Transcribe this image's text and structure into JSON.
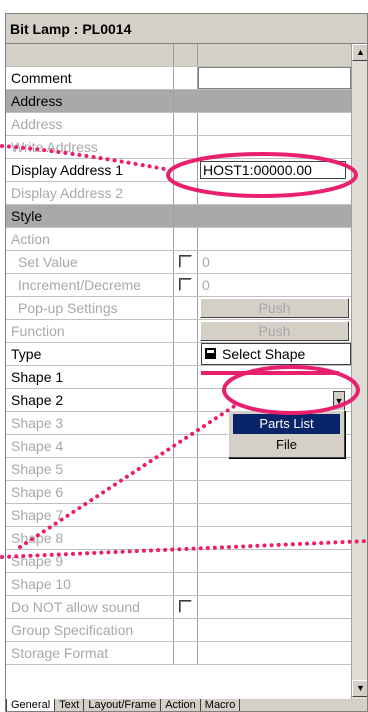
{
  "window": {
    "title": "Bit Lamp : PL0014"
  },
  "rows": [
    {
      "label": "Comment",
      "style": "normal",
      "value": "",
      "col2": "empty"
    },
    {
      "label": "Address",
      "style": "section"
    },
    {
      "label": "Address",
      "style": "disabled",
      "value": ""
    },
    {
      "label": "Write Address",
      "style": "disabled",
      "value": ""
    },
    {
      "label": "Display Address 1",
      "style": "normal",
      "value": "HOST1:00000.00"
    },
    {
      "label": "Display Address 2",
      "style": "disabled",
      "value": ""
    },
    {
      "label": "Style",
      "style": "section"
    },
    {
      "label": "Action",
      "style": "disabled",
      "value": ""
    },
    {
      "label": "Set Value",
      "style": "disabled-indent",
      "value": "0",
      "check": true
    },
    {
      "label": "Increment/Decreme",
      "style": "disabled-indent",
      "value": "0",
      "check": true
    },
    {
      "label": "Pop-up Settings",
      "style": "disabled-indent",
      "button": "Push"
    },
    {
      "label": "Function",
      "style": "disabled",
      "button": "Push"
    },
    {
      "label": "Type",
      "style": "normal",
      "value": ""
    },
    {
      "label": "Shape 1",
      "style": "normal",
      "value": ""
    },
    {
      "label": "Shape 2",
      "style": "normal",
      "value": ""
    },
    {
      "label": "Shape 3",
      "style": "disabled",
      "value": ""
    },
    {
      "label": "Shape 4",
      "style": "disabled",
      "value": ""
    },
    {
      "label": "Shape 5",
      "style": "disabled",
      "value": ""
    },
    {
      "label": "Shape 6",
      "style": "disabled",
      "value": ""
    },
    {
      "label": "Shape 7",
      "style": "disabled",
      "value": ""
    },
    {
      "label": "Shape 8",
      "style": "disabled",
      "value": ""
    },
    {
      "label": "Shape 9",
      "style": "disabled",
      "value": ""
    },
    {
      "label": "Shape 10",
      "style": "disabled",
      "value": ""
    },
    {
      "label": "Do NOT allow sound",
      "style": "disabled",
      "value": "",
      "check": true
    },
    {
      "label": "Group Specification",
      "style": "disabled",
      "value": ""
    },
    {
      "label": "Storage Format",
      "style": "disabled",
      "value": ""
    }
  ],
  "shape_dropdown": {
    "label": "Select Shape"
  },
  "popup_menu": {
    "items": [
      "Parts List",
      "File"
    ]
  },
  "tabs": [
    "General",
    "Text",
    "Layout/Frame",
    "Action",
    "Macro"
  ],
  "colors": {
    "annotation": "#e8206e",
    "selection": "#0a246a"
  }
}
